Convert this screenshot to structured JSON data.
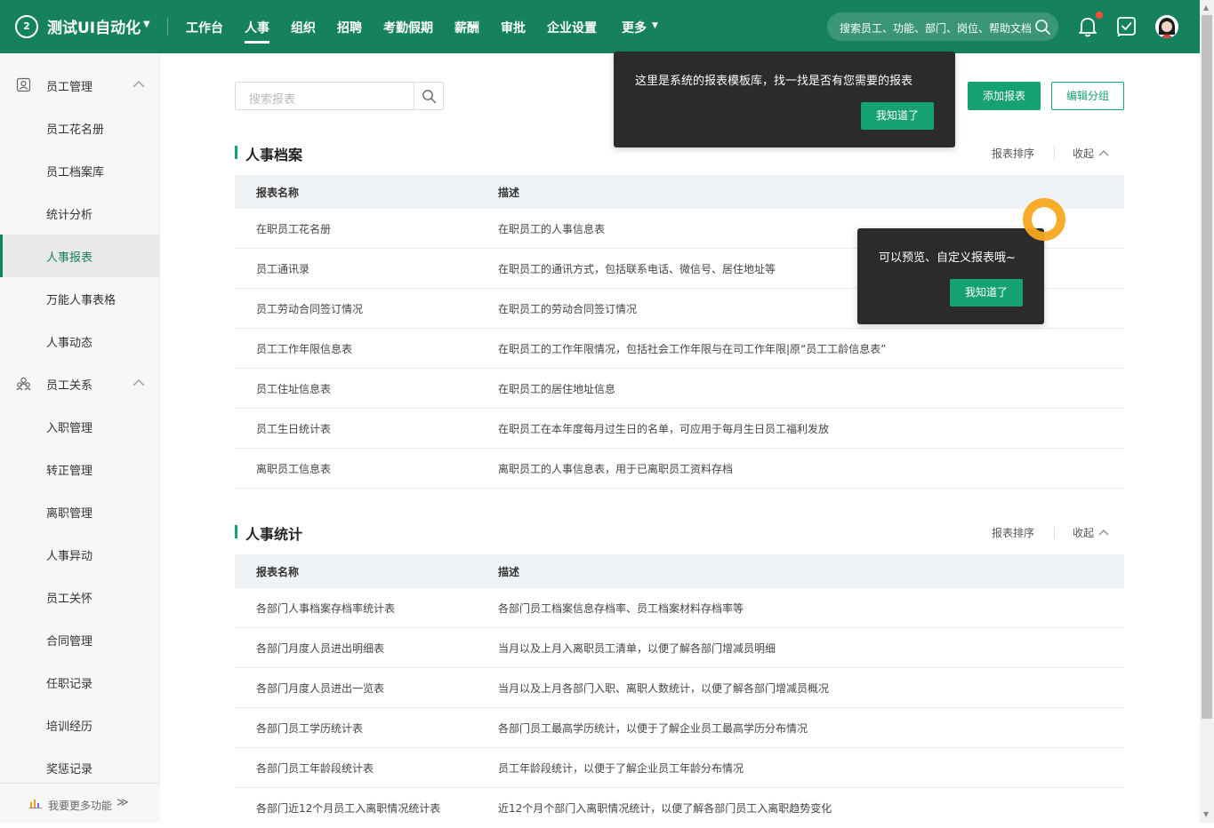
{
  "colors": {
    "brand": "#16825b",
    "accent": "#16a270",
    "tooltip_bg": "#2b2b2b",
    "pulse": "#f7a821",
    "badge": "#ff4d3a"
  },
  "app": {
    "logo_text": "2",
    "name": "测试UI自动化"
  },
  "nav": [
    "工作台",
    "人事",
    "组织",
    "招聘",
    "考勤假期",
    "薪酬",
    "审批",
    "企业设置",
    "更多"
  ],
  "nav_active": "人事",
  "top_search": {
    "placeholder": "搜索员工、功能、部门、岗位、帮助文档"
  },
  "sidebar": {
    "items": [
      {
        "label": "员工管理",
        "kind": "group",
        "icon": "person-card-icon",
        "expanded": true
      },
      {
        "label": "员工花名册",
        "kind": "item"
      },
      {
        "label": "员工档案库",
        "kind": "item"
      },
      {
        "label": "统计分析",
        "kind": "item"
      },
      {
        "label": "人事报表",
        "kind": "item",
        "active": true
      },
      {
        "label": "万能人事表格",
        "kind": "item"
      },
      {
        "label": "人事动态",
        "kind": "item"
      },
      {
        "label": "员工关系",
        "kind": "group",
        "icon": "people-icon",
        "expanded": true
      },
      {
        "label": "入职管理",
        "kind": "item"
      },
      {
        "label": "转正管理",
        "kind": "item"
      },
      {
        "label": "离职管理",
        "kind": "item"
      },
      {
        "label": "人事异动",
        "kind": "item"
      },
      {
        "label": "员工关怀",
        "kind": "item"
      },
      {
        "label": "合同管理",
        "kind": "item"
      },
      {
        "label": "任职记录",
        "kind": "item"
      },
      {
        "label": "培训经历",
        "kind": "item"
      },
      {
        "label": "奖惩记录",
        "kind": "item"
      }
    ],
    "footer": {
      "label": "我要更多功能",
      "icon": "bar-chart-icon"
    }
  },
  "toolbar": {
    "search_placeholder": "搜索报表",
    "add_label": "添加报表",
    "edit_label": "编辑分组"
  },
  "sections": [
    {
      "title": "人事档案",
      "sort_label": "报表排序",
      "collapse_label": "收起",
      "columns": [
        "报表名称",
        "描述"
      ],
      "rows": [
        {
          "name": "在职员工花名册",
          "desc": "在职员工的人事信息表"
        },
        {
          "name": "员工通讯录",
          "desc": "在职员工的通讯方式，包括联系电话、微信号、居住地址等"
        },
        {
          "name": "员工劳动合同签订情况",
          "desc": "在职员工的劳动合同签订情况"
        },
        {
          "name": "员工工作年限信息表",
          "desc": "在职员工的工作年限情况，包括社会工作年限与在司工作年限|原“员工工龄信息表”"
        },
        {
          "name": "员工住址信息表",
          "desc": "在职员工的居住地址信息"
        },
        {
          "name": "员工生日统计表",
          "desc": "在职员工在本年度每月过生日的名单，可应用于每月生日员工福利发放"
        },
        {
          "name": "离职员工信息表",
          "desc": "离职员工的人事信息表，用于已离职员工资料存档"
        }
      ]
    },
    {
      "title": "人事统计",
      "sort_label": "报表排序",
      "collapse_label": "收起",
      "columns": [
        "报表名称",
        "描述"
      ],
      "rows": [
        {
          "name": "各部门人事档案存档率统计表",
          "desc": "各部门员工档案信息存档率、员工档案材料存档率等"
        },
        {
          "name": "各部门月度人员进出明细表",
          "desc": "当月以及上月入离职员工清单，以便了解各部门增减员明细"
        },
        {
          "name": "各部门月度人员进出一览表",
          "desc": "当月以及上月各部门入职、离职人数统计，以便了解各部门增减员概况"
        },
        {
          "name": "各部门员工学历统计表",
          "desc": "各部门员工最高学历统计，以便于了解企业员工最高学历分布情况"
        },
        {
          "name": "各部门员工年龄段统计表",
          "desc": "员工年龄段统计，以便于了解企业员工年龄分布情况"
        },
        {
          "name": "各部门近12个月员工入离职情况统计表",
          "desc": "近12个月个部门入离职情况统计，以便了解各部门员工入离职趋势变化"
        }
      ]
    }
  ],
  "tooltips": {
    "library": {
      "text": "这里是系统的报表模板库，找一找是否有您需要的报表",
      "button": "我知道了"
    },
    "preview": {
      "text": "可以预览、自定义报表哦~",
      "button": "我知道了"
    }
  }
}
